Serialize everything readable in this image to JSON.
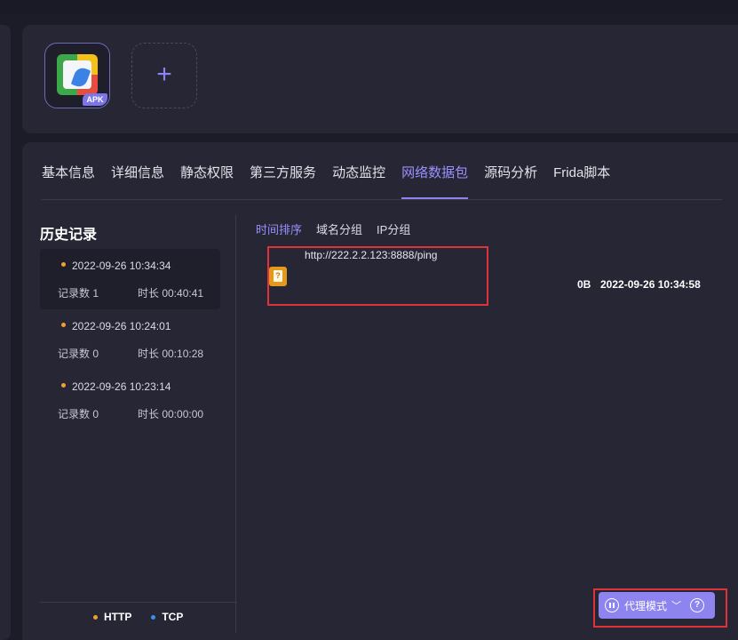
{
  "app": {
    "apk_badge": "APK",
    "add_symbol": "+"
  },
  "tabs": [
    {
      "label": "基本信息"
    },
    {
      "label": "详细信息"
    },
    {
      "label": "静态权限"
    },
    {
      "label": "第三方服务"
    },
    {
      "label": "动态监控"
    },
    {
      "label": "网络数据包",
      "active": true
    },
    {
      "label": "源码分析"
    },
    {
      "label": "Frida脚本"
    }
  ],
  "history": {
    "title": "历史记录",
    "items": [
      {
        "time": "2022-09-26 10:34:34",
        "count": "记录数 1",
        "duration": "时长 00:40:41",
        "selected": true
      },
      {
        "time": "2022-09-26 10:24:01",
        "count": "记录数 0",
        "duration": "时长 00:10:28"
      },
      {
        "time": "2022-09-26 10:23:14",
        "count": "记录数 0",
        "duration": "时长 00:00:00"
      }
    ],
    "legend": [
      {
        "label": "HTTP",
        "color": "#f0a030"
      },
      {
        "label": "TCP",
        "color": "#3d8ef0"
      }
    ]
  },
  "sort_tabs": [
    {
      "label": "时间排序",
      "active": true
    },
    {
      "label": "域名分组"
    },
    {
      "label": "IP分组"
    }
  ],
  "packets": [
    {
      "url": "http://222.2.2.123:8888/ping",
      "size": "0B",
      "time": "2022-09-26 10:34:58",
      "icon": "unknown-file-icon"
    }
  ],
  "proxy": {
    "label": "代理模式",
    "chevron": "﹀",
    "help": "?"
  },
  "colors": {
    "accent": "#8d84f0",
    "highlight": "#e0323a",
    "http_dot": "#f0a030",
    "tcp_dot": "#3d8ef0"
  }
}
